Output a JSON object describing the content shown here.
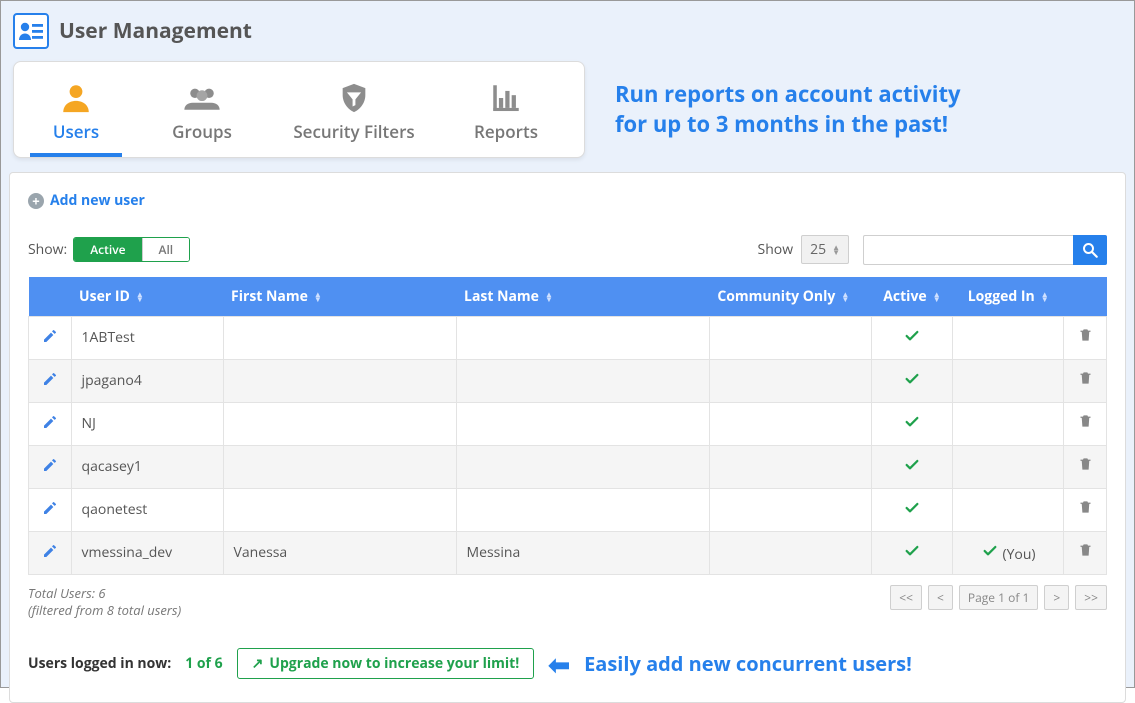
{
  "header": {
    "title": "User Management"
  },
  "tabs": [
    {
      "label": "Users",
      "active": true
    },
    {
      "label": "Groups"
    },
    {
      "label": "Security Filters"
    },
    {
      "label": "Reports"
    }
  ],
  "banner": {
    "line1": "Run reports on account activity",
    "line2": "for up to 3 months in the past!"
  },
  "actions": {
    "add_user": "Add new user"
  },
  "toolbar": {
    "show_label": "Show:",
    "toggle_active": "Active",
    "toggle_all": "All",
    "show2_label": "Show",
    "page_size": "25"
  },
  "columns": {
    "user_id": "User ID",
    "first_name": "First Name",
    "last_name": "Last Name",
    "community_only": "Community Only",
    "active": "Active",
    "logged_in": "Logged In"
  },
  "rows": [
    {
      "user_id": "1ABTest",
      "first_name": "",
      "last_name": "",
      "community_only": "",
      "active": true,
      "logged_in": "",
      "you": false
    },
    {
      "user_id": "jpagano4",
      "first_name": "",
      "last_name": "",
      "community_only": "",
      "active": true,
      "logged_in": "",
      "you": false
    },
    {
      "user_id": "NJ",
      "first_name": "",
      "last_name": "",
      "community_only": "",
      "active": true,
      "logged_in": "",
      "you": false
    },
    {
      "user_id": "qacasey1",
      "first_name": "",
      "last_name": "",
      "community_only": "",
      "active": true,
      "logged_in": "",
      "you": false
    },
    {
      "user_id": "qaonetest",
      "first_name": "",
      "last_name": "",
      "community_only": "",
      "active": true,
      "logged_in": "",
      "you": false
    },
    {
      "user_id": "vmessina_dev",
      "first_name": "Vanessa",
      "last_name": "Messina",
      "community_only": "",
      "active": true,
      "logged_in": "(You)",
      "you": true
    }
  ],
  "footer": {
    "total_line": "Total Users: 6",
    "filtered_line": "(filtered from 8 total users)"
  },
  "pager": {
    "first": "<<",
    "prev": "<",
    "page": "Page 1 of 1",
    "next": ">",
    "last": ">>"
  },
  "logged_now": {
    "label": "Users logged in now:",
    "count": "1 of 6",
    "upgrade": "Upgrade now to increase your limit!",
    "callout": "Easily add new concurrent users!"
  }
}
